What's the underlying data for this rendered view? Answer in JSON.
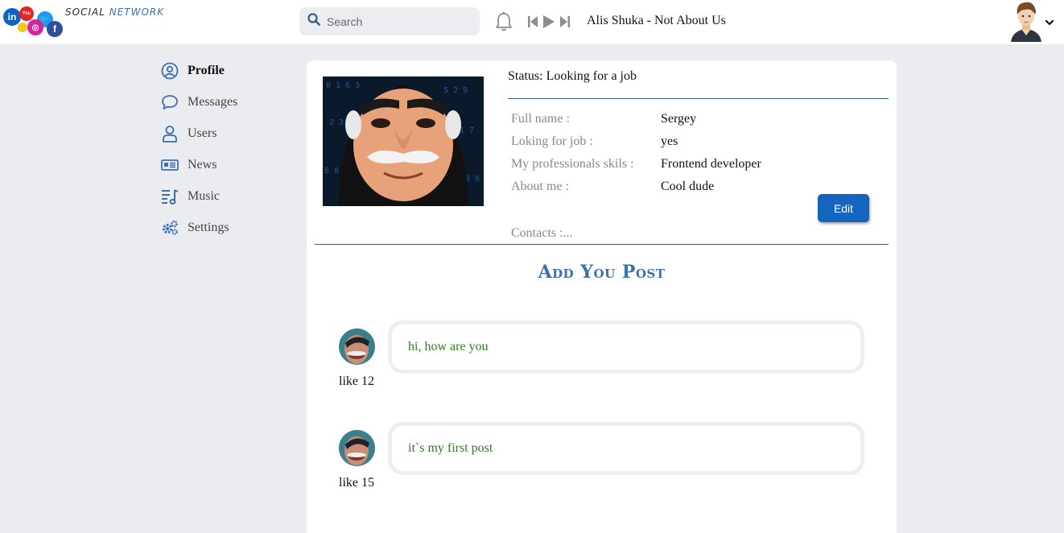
{
  "header": {
    "brand_prefix": "SOCIAL ",
    "brand_accent": "NETWORK",
    "search_placeholder": "Search",
    "now_playing": "Alis Shuka - Not About Us"
  },
  "sidebar": {
    "items": [
      {
        "label": "Profile",
        "icon": "user-circle-icon",
        "active": true
      },
      {
        "label": "Messages",
        "icon": "chat-bubble-icon"
      },
      {
        "label": "Users",
        "icon": "user-icon"
      },
      {
        "label": "News",
        "icon": "newspaper-icon"
      },
      {
        "label": "Music",
        "icon": "music-list-icon"
      },
      {
        "label": "Settings",
        "icon": "gears-icon"
      }
    ]
  },
  "profile": {
    "status": "Status: Looking for a job",
    "fields": [
      {
        "key": "Full name :",
        "value": "Sergey"
      },
      {
        "key": "Loking for job :",
        "value": "yes"
      },
      {
        "key": "My professionals skils :",
        "value": "Frontend developer"
      },
      {
        "key": "About me :",
        "value": "Cool dude"
      }
    ],
    "edit_label": "Edit",
    "contacts": "Contacts :..."
  },
  "posts_section": {
    "title": "Add You Post",
    "posts": [
      {
        "text": "hi, how are you",
        "likes": "like 12"
      },
      {
        "text": "it`s my first post",
        "likes": "like 15"
      }
    ]
  },
  "colors": {
    "accent": "#3d6fb5",
    "button": "#1565c0",
    "post_text": "#2e7d1e",
    "background": "#eaecef"
  }
}
